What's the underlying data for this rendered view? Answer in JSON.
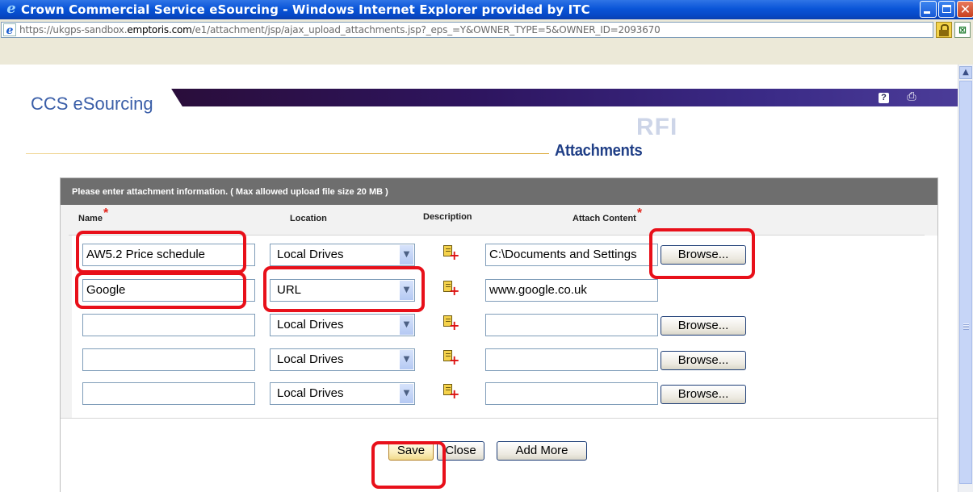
{
  "window": {
    "title": "Crown Commercial Service eSourcing - Windows Internet Explorer provided by ITC",
    "url_prefix": "https://ukgps-sandbox.",
    "url_domain": "emptoris.com",
    "url_suffix": "/e1/attachment/jsp/ajax_upload_attachments.jsp?_eps_=Y&OWNER_TYPE=5&OWNER_ID=2093670",
    "ie_logo": "e",
    "close_glyph": "✕"
  },
  "header": {
    "brand": "CCS eSourcing",
    "help_glyph": "?",
    "print_glyph": "⎙",
    "watermark": "RFI",
    "section_title": "Attachments"
  },
  "form": {
    "instruction": "Please enter attachment information. ( Max allowed upload file size 20 MB )",
    "columns": {
      "name": "Name",
      "location": "Location",
      "description": "Description",
      "attach_content": "Attach Content"
    },
    "required_mark": "*",
    "dropdown_glyph": "▼",
    "rows": [
      {
        "name": "AW5.2 Price schedule",
        "location": "Local Drives",
        "content": "C:\\Documents and Settings",
        "browse": "Browse..."
      },
      {
        "name": "Google",
        "location": "URL",
        "content": "www.google.co.uk",
        "browse": ""
      },
      {
        "name": "",
        "location": "Local Drives",
        "content": "",
        "browse": "Browse..."
      },
      {
        "name": "",
        "location": "Local Drives",
        "content": "",
        "browse": "Browse..."
      },
      {
        "name": "",
        "location": "Local Drives",
        "content": "",
        "browse": "Browse..."
      }
    ],
    "buttons": {
      "save": "Save",
      "close": "Close",
      "add_more": "Add More"
    }
  },
  "colors": {
    "titlebar": "#0a55d8",
    "band": "#2e1560",
    "brand_text": "#3a5ea8",
    "panel_header": "#6e6e6e",
    "annotation": "#e8101a"
  }
}
